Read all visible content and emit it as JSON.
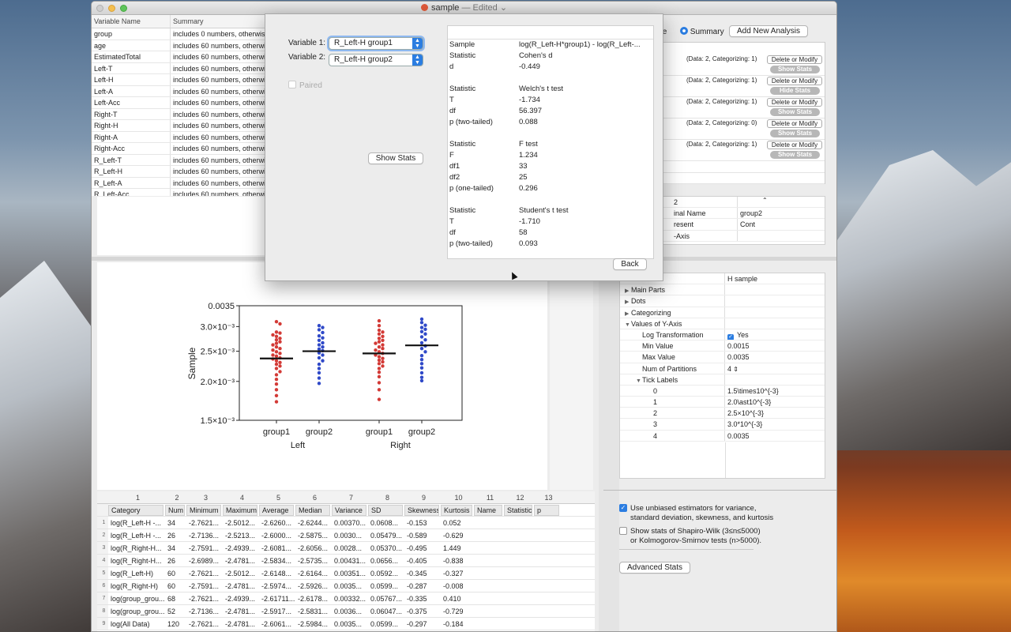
{
  "window": {
    "title": "sample",
    "title_suffix": " — Edited",
    "chevron": "⌄"
  },
  "variables": {
    "headers": [
      "Variable Name",
      "Summary"
    ],
    "rows": [
      [
        "group",
        "includes 0 numbers, otherwise"
      ],
      [
        "age",
        "includes 60 numbers, otherwise"
      ],
      [
        "EstimatedTotal",
        "includes 60 numbers, otherwise"
      ],
      [
        "Left-T",
        "includes 60 numbers, otherwise"
      ],
      [
        "Left-H",
        "includes 60 numbers, otherwise"
      ],
      [
        "Left-A",
        "includes 60 numbers, otherwise"
      ],
      [
        "Left-Acc",
        "includes 60 numbers, otherwise"
      ],
      [
        "Right-T",
        "includes 60 numbers, otherwise"
      ],
      [
        "Right-H",
        "includes 60 numbers, otherwise"
      ],
      [
        "Right-A",
        "includes 60 numbers, otherwise"
      ],
      [
        "Right-Acc",
        "includes 60 numbers, otherwise"
      ],
      [
        "R_Left-T",
        "includes 60 numbers, otherwise"
      ],
      [
        "R_Left-H",
        "includes 60 numbers, otherwise"
      ],
      [
        "R_Left-A",
        "includes 60 numbers, otherwise"
      ],
      [
        "R_Left-Acc",
        "includes 60 numbers, otherwise"
      ]
    ]
  },
  "analysis": {
    "radio_left": "ble",
    "radio_summary": "Summary",
    "add_button": "Add New Analysis",
    "rows": [
      {
        "info": "(Data: 2, Categorizing: 1)",
        "modify": "Delete or Modify",
        "stats": "Show Stats"
      },
      {
        "info": "(Data: 2, Categorizing: 1)",
        "modify": "Delete or Modify",
        "stats": "Hide Stats"
      },
      {
        "info": "(Data: 2, Categorizing: 1)",
        "modify": "Delete or Modify",
        "stats": "Show Stats"
      },
      {
        "info": "(Data: 2, Categorizing: 0)",
        "modify": "Delete or Modify",
        "stats": "Show Stats"
      },
      {
        "info": "(Data: 2, Categorizing: 1)",
        "modify": "Delete or Modify",
        "stats": "Show Stats"
      }
    ]
  },
  "var_props": [
    {
      "label": "2",
      "value": ""
    },
    {
      "label": "inal Name",
      "value": "group2"
    },
    {
      "label": "resent",
      "value": "Cont"
    },
    {
      "label": "-Axis",
      "value": ""
    }
  ],
  "chart_data": {
    "type": "scatter",
    "ylabel": "Sample",
    "ylim": [
      0.0015,
      0.0035
    ],
    "yticks": [
      {
        "v": 0.0015,
        "label": "1.5×10⁻³"
      },
      {
        "v": 0.002,
        "label": "2.0×10⁻³"
      },
      {
        "v": 0.0025,
        "label": "2.5×10⁻³"
      },
      {
        "v": 0.003,
        "label": "3.0×10⁻³"
      },
      {
        "v": 0.0035,
        "label": "0.0035"
      }
    ],
    "categories": [
      "group1",
      "group2",
      "group1",
      "group2"
    ],
    "group_labels": [
      "Left",
      "Right"
    ],
    "series": [
      {
        "category": "group1",
        "group": "Left",
        "color": "#d33a36",
        "median": 0.00237,
        "values": [
          0.00311,
          0.00306,
          0.00288,
          0.00286,
          0.00282,
          0.00279,
          0.00275,
          0.00272,
          0.00268,
          0.00265,
          0.00262,
          0.00258,
          0.00255,
          0.00252,
          0.00249,
          0.00246,
          0.00243,
          0.00241,
          0.00238,
          0.00236,
          0.00233,
          0.0023,
          0.00227,
          0.00224,
          0.0022,
          0.00215,
          0.0021,
          0.00203,
          0.00196,
          0.00188,
          0.0018,
          0.00172
        ]
      },
      {
        "category": "group2",
        "group": "Left",
        "color": "#2f49c8",
        "median": 0.0025,
        "values": [
          0.00302,
          0.00298,
          0.00293,
          0.00287,
          0.0028,
          0.00276,
          0.00271,
          0.00266,
          0.00262,
          0.00258,
          0.00254,
          0.00251,
          0.00247,
          0.00243,
          0.00238,
          0.00233,
          0.00227,
          0.0022,
          0.00213,
          0.00205,
          0.00197
        ]
      },
      {
        "category": "group1",
        "group": "Right",
        "color": "#d33a36",
        "median": 0.00246,
        "values": [
          0.00313,
          0.00302,
          0.00292,
          0.00288,
          0.00284,
          0.00279,
          0.00275,
          0.00271,
          0.00268,
          0.00265,
          0.00262,
          0.00258,
          0.00255,
          0.00252,
          0.00249,
          0.00246,
          0.00243,
          0.0024,
          0.00237,
          0.00234,
          0.00231,
          0.00228,
          0.00224,
          0.0022,
          0.00214,
          0.00207,
          0.00198,
          0.00188,
          0.00175
        ]
      },
      {
        "category": "group2",
        "group": "Right",
        "color": "#2f49c8",
        "median": 0.00261,
        "values": [
          0.00317,
          0.00309,
          0.00303,
          0.00298,
          0.00294,
          0.00289,
          0.00284,
          0.00278,
          0.00272,
          0.00266,
          0.0026,
          0.00255,
          0.00249,
          0.00242,
          0.00235,
          0.00228,
          0.00221,
          0.00213,
          0.00206,
          0.00201
        ]
      }
    ]
  },
  "stats_grid": {
    "col_numbers": [
      "1",
      "2",
      "3",
      "4",
      "5",
      "6",
      "7",
      "8",
      "9",
      "10",
      "11",
      "12",
      "13"
    ],
    "headers": [
      "Category",
      "Num",
      "Minimum",
      "Maximum",
      "Average",
      "Median",
      "Variance",
      "SD",
      "Skewness",
      "Kurtosis",
      "Name",
      "Statistic",
      "p"
    ],
    "rows": [
      [
        "log(R_Left-H -...",
        "34",
        "-2.7621...",
        "-2.5012...",
        "-2.6260...",
        "-2.6244...",
        "0.00370...",
        "0.0608...",
        "-0.153",
        "0.052"
      ],
      [
        "log(R_Left-H -...",
        "26",
        "-2.7136...",
        "-2.5213...",
        "-2.6000...",
        "-2.5875...",
        "0.0030...",
        "0.05479...",
        "-0.589",
        "-0.629"
      ],
      [
        "log(R_Right-H...",
        "34",
        "-2.7591...",
        "-2.4939...",
        "-2.6081...",
        "-2.6056...",
        "0.0028...",
        "0.05370...",
        "-0.495",
        "1.449"
      ],
      [
        "log(R_Right-H...",
        "26",
        "-2.6989...",
        "-2.4781...",
        "-2.5834...",
        "-2.5735...",
        "0.00431...",
        "0.0656...",
        "-0.405",
        "-0.838"
      ],
      [
        "log(R_Left-H)",
        "60",
        "-2.7621...",
        "-2.5012...",
        "-2.6148...",
        "-2.6164...",
        "0.00351...",
        "0.0592...",
        "-0.345",
        "-0.327"
      ],
      [
        "log(R_Right-H)",
        "60",
        "-2.7591...",
        "-2.4781...",
        "-2.5974...",
        "-2.5926...",
        "0.0035...",
        "0.0599...",
        "-0.287",
        "-0.008"
      ],
      [
        "log(group_grou...",
        "68",
        "-2.7621...",
        "-2.4939...",
        "-2.61711...",
        "-2.6178...",
        "0.00332...",
        "0.05767...",
        "-0.335",
        "0.410"
      ],
      [
        "log(group_grou...",
        "52",
        "-2.7136...",
        "-2.4781...",
        "-2.5917...",
        "-2.5831...",
        "0.0036...",
        "0.06047...",
        "-0.375",
        "-0.729"
      ],
      [
        "log(All Data)",
        "120",
        "-2.7621...",
        "-2.4781...",
        "-2.6061...",
        "-2.5984...",
        "0.0035...",
        "0.0599...",
        "-0.297",
        "-0.184"
      ]
    ]
  },
  "graph_props": [
    {
      "label": "",
      "value": "H sample",
      "indent": 0,
      "tri": ""
    },
    {
      "label": "Main Parts",
      "value": "",
      "indent": 0,
      "tri": "▶"
    },
    {
      "label": "Dots",
      "value": "",
      "indent": 0,
      "tri": "▶"
    },
    {
      "label": "Categorizing",
      "value": "",
      "indent": 0,
      "tri": "▶"
    },
    {
      "label": "Values of Y-Axis",
      "value": "",
      "indent": 0,
      "tri": "▼"
    },
    {
      "label": "Log Transformation",
      "value": "Yes",
      "indent": 1,
      "tri": "",
      "check": true
    },
    {
      "label": "Min Value",
      "value": "0.0015",
      "indent": 1,
      "tri": ""
    },
    {
      "label": "Max Value",
      "value": "0.0035",
      "indent": 1,
      "tri": ""
    },
    {
      "label": "Num of Partitions",
      "value": "4",
      "indent": 1,
      "tri": "",
      "stepper": true
    },
    {
      "label": "Tick Labels",
      "value": "",
      "indent": 1,
      "tri": "▼"
    },
    {
      "label": "0",
      "value": "1.5\\times10^{-3}",
      "indent": 2,
      "tri": ""
    },
    {
      "label": "1",
      "value": "2.0\\ast10^{-3}",
      "indent": 2,
      "tri": ""
    },
    {
      "label": "2",
      "value": "2.5×10^{-3}",
      "indent": 2,
      "tri": ""
    },
    {
      "label": "3",
      "value": "3.0*10^{-3}",
      "indent": 2,
      "tri": ""
    },
    {
      "label": "4",
      "value": "0.0035",
      "indent": 2,
      "tri": ""
    }
  ],
  "options": {
    "unbiased": "Use unbiased estimators for variance,\nstandard deviation, skewness, and kurtosis",
    "shapiro": "Show stats of Shapiro-Wilk (3≤n≤5000)\nor Kolmogorov-Smirnov tests (n>5000).",
    "advanced": "Advanced Stats"
  },
  "dialog": {
    "var1_label": "Variable 1:",
    "var1_value": "R_Left-H group1",
    "var2_label": "Variable 2:",
    "var2_value": "R_Left-H group2",
    "paired_label": "Paired",
    "show_stats": "Show Stats",
    "back": "Back",
    "results": [
      [
        "",
        ""
      ],
      [
        "Sample",
        "log(R_Left-H*group1) - log(R_Left-..."
      ],
      [
        "Statistic",
        "Cohen's d"
      ],
      [
        "d",
        "-0.449"
      ],
      [
        "",
        ""
      ],
      [
        "Statistic",
        "Welch's t test"
      ],
      [
        "T",
        "-1.734"
      ],
      [
        "df",
        "56.397"
      ],
      [
        "p (two-tailed)",
        "0.088"
      ],
      [
        "",
        ""
      ],
      [
        "Statistic",
        "F test"
      ],
      [
        "F",
        "1.234"
      ],
      [
        "df1",
        "33"
      ],
      [
        "df2",
        "25"
      ],
      [
        "p (one-tailed)",
        "0.296"
      ],
      [
        "",
        ""
      ],
      [
        "Statistic",
        "Student's t test"
      ],
      [
        "T",
        "-1.710"
      ],
      [
        "df",
        "58"
      ],
      [
        "p (two-tailed)",
        "0.093"
      ]
    ]
  }
}
